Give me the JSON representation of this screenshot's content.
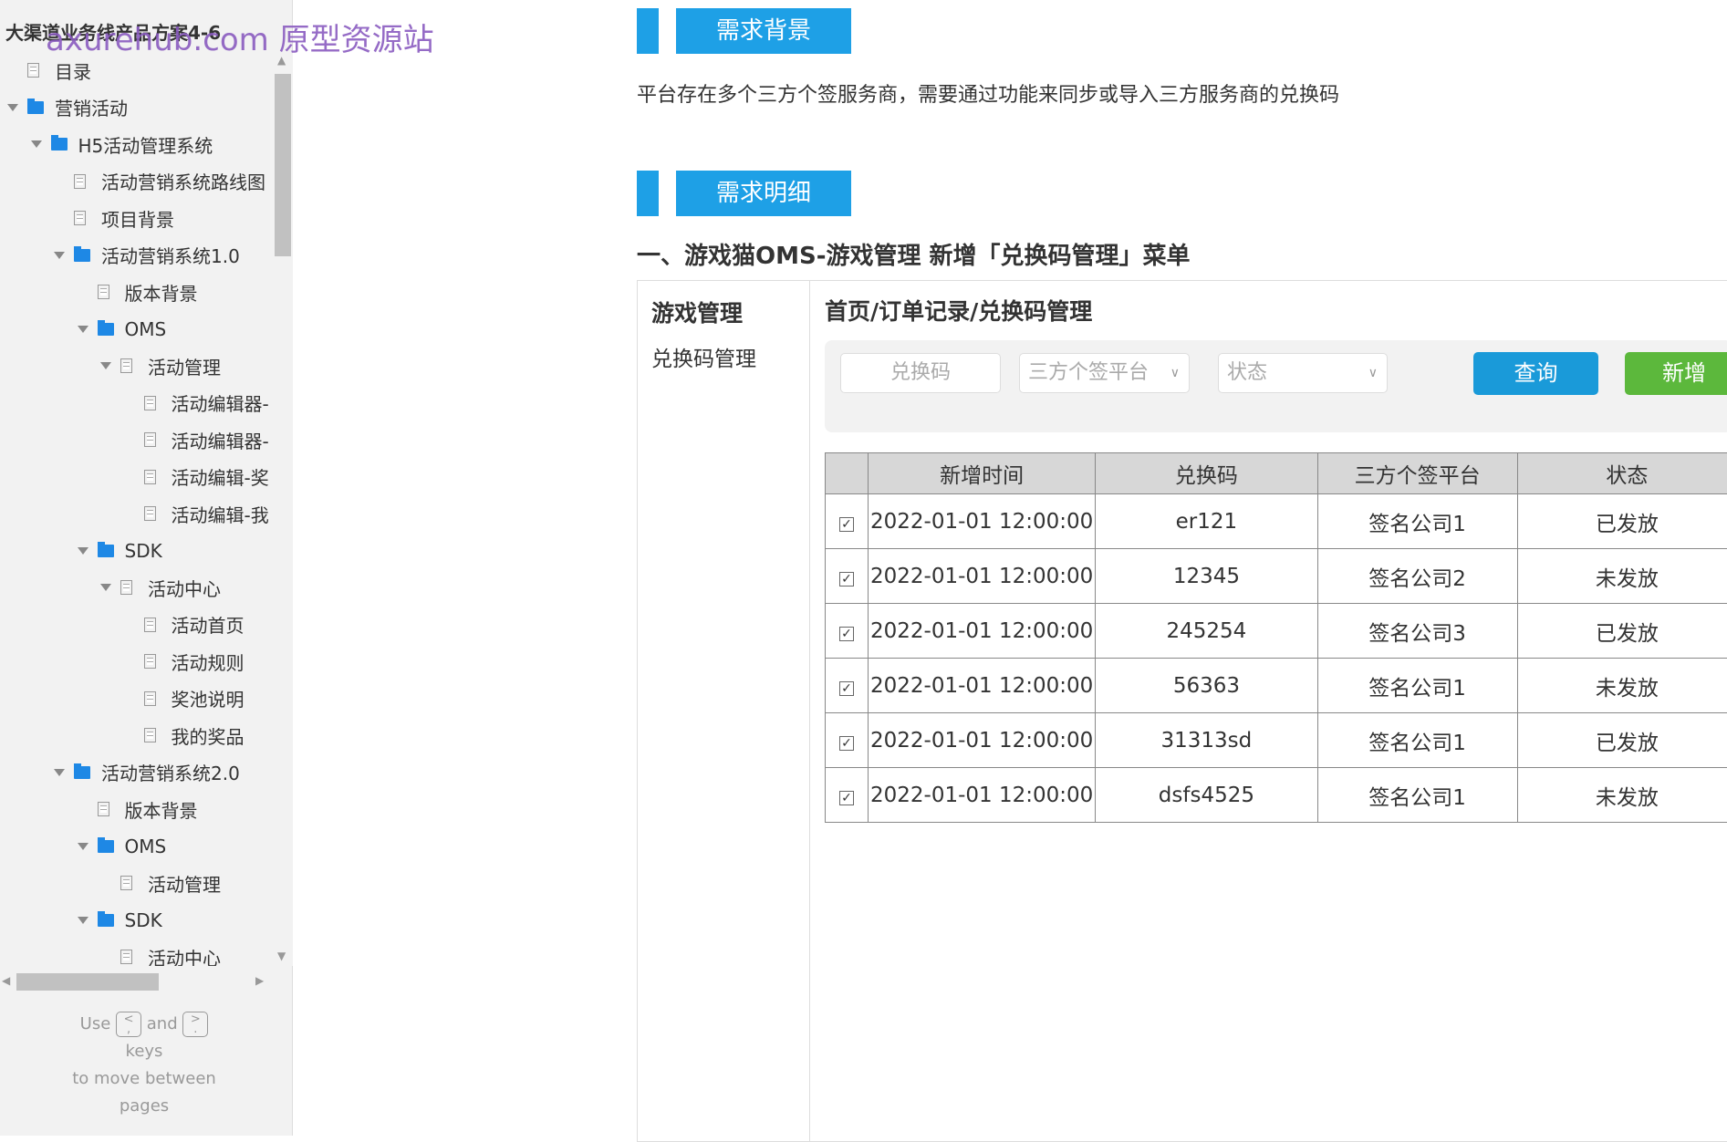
{
  "sidebar": {
    "title": "大渠道业务线产品方案4-6",
    "watermark": "axurehub.com 原型资源站",
    "items": [
      {
        "label": "目录",
        "type": "doc",
        "level": 0,
        "arrow": false
      },
      {
        "label": "营销活动",
        "type": "folder",
        "level": 0,
        "arrow": true
      },
      {
        "label": "H5活动管理系统",
        "type": "folder",
        "level": 1,
        "arrow": true
      },
      {
        "label": "活动营销系统路线图",
        "type": "doc",
        "level": 2,
        "arrow": false
      },
      {
        "label": "项目背景",
        "type": "doc",
        "level": 2,
        "arrow": false
      },
      {
        "label": "活动营销系统1.0",
        "type": "folder",
        "level": 2,
        "arrow": true
      },
      {
        "label": "版本背景",
        "type": "doc",
        "level": 3,
        "arrow": false
      },
      {
        "label": "OMS",
        "type": "folder",
        "level": 3,
        "arrow": true
      },
      {
        "label": "活动管理",
        "type": "doc",
        "level": 4,
        "arrow": true
      },
      {
        "label": "活动编辑器-",
        "type": "doc",
        "level": 5,
        "arrow": false
      },
      {
        "label": "活动编辑器-",
        "type": "doc",
        "level": 5,
        "arrow": false
      },
      {
        "label": "活动编辑-奖",
        "type": "doc",
        "level": 5,
        "arrow": false
      },
      {
        "label": "活动编辑-我",
        "type": "doc",
        "level": 5,
        "arrow": false
      },
      {
        "label": "SDK",
        "type": "folder",
        "level": 3,
        "arrow": true
      },
      {
        "label": "活动中心",
        "type": "doc",
        "level": 4,
        "arrow": true
      },
      {
        "label": "活动首页",
        "type": "doc",
        "level": 5,
        "arrow": false
      },
      {
        "label": "活动规则",
        "type": "doc",
        "level": 5,
        "arrow": false
      },
      {
        "label": "奖池说明",
        "type": "doc",
        "level": 5,
        "arrow": false
      },
      {
        "label": "我的奖品",
        "type": "doc",
        "level": 5,
        "arrow": false
      },
      {
        "label": "活动营销系统2.0",
        "type": "folder",
        "level": 2,
        "arrow": true
      },
      {
        "label": "版本背景",
        "type": "doc",
        "level": 3,
        "arrow": false
      },
      {
        "label": "OMS",
        "type": "folder",
        "level": 3,
        "arrow": true
      },
      {
        "label": "活动管理",
        "type": "doc",
        "level": 4,
        "arrow": false
      },
      {
        "label": "SDK",
        "type": "folder",
        "level": 3,
        "arrow": true
      },
      {
        "label": "活动中心",
        "type": "doc",
        "level": 4,
        "arrow": false
      }
    ],
    "help": {
      "use": "Use",
      "key1": "<\n,",
      "and": "and",
      "key2": ">\n.",
      "keys": "keys",
      "move": "to move between",
      "pages": "pages"
    }
  },
  "main": {
    "section1": "需求背景",
    "bg_text": "平台存在多个三方个签服务商，需要通过功能来同步或导入三方服务商的兑换码",
    "section2": "需求明细",
    "heading": "一、游戏猫OMS-游戏管理 新增「兑换码管理」菜单"
  },
  "proto": {
    "menu_title": "游戏管理",
    "menu_item": "兑换码管理",
    "breadcrumb": "首页/订单记录/兑换码管理",
    "filter": {
      "code_placeholder": "兑换码",
      "platform": "三方个签平台",
      "status": "状态",
      "query": "查询",
      "add": "新增"
    },
    "columns": [
      "新增时间",
      "兑换码",
      "三方个签平台",
      "状态"
    ],
    "rows": [
      [
        "2022-01-01 12:00:00",
        "er121",
        "签名公司1",
        "已发放"
      ],
      [
        "2022-01-01 12:00:00",
        "12345",
        "签名公司2",
        "未发放"
      ],
      [
        "2022-01-01 12:00:00",
        "245254",
        "签名公司3",
        "已发放"
      ],
      [
        "2022-01-01 12:00:00",
        "56363",
        "签名公司1",
        "未发放"
      ],
      [
        "2022-01-01 12:00:00",
        "31313sd",
        "签名公司1",
        "已发放"
      ],
      [
        "2022-01-01 12:00:00",
        "dsfs4525",
        "签名公司1",
        "未发放"
      ]
    ],
    "colors": {
      "query": "#1a9ad9",
      "add": "#5cb83c",
      "accent": "#1ea0e6"
    }
  }
}
